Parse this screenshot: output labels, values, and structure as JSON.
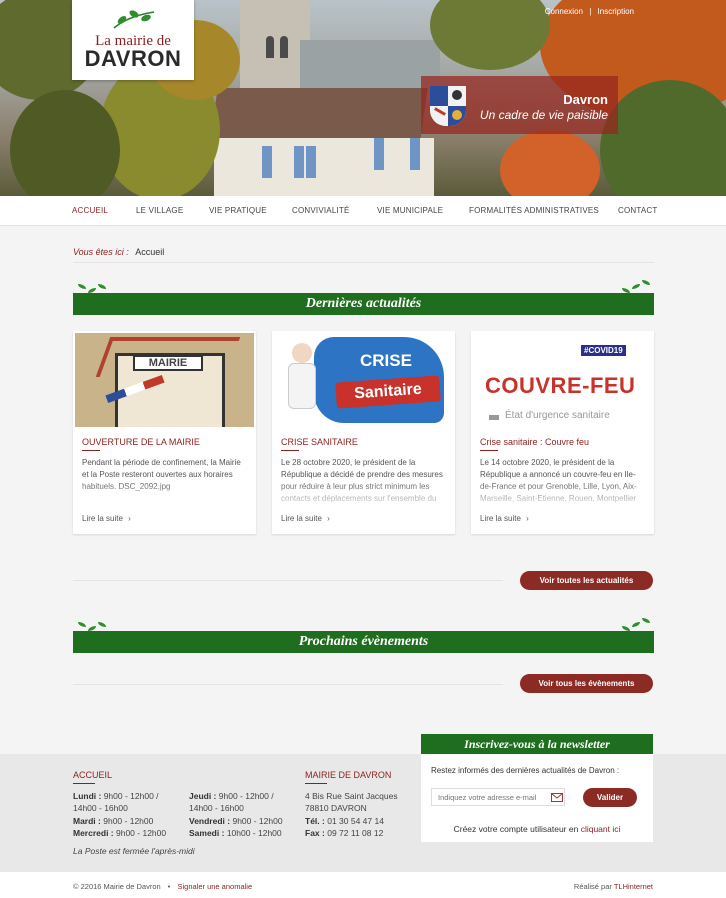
{
  "header": {
    "logo_line1": "La mairie de",
    "logo_line2": "DAVRON",
    "login": "Connexion",
    "separator": "|",
    "register": "Inscription",
    "banner_title": "Davron",
    "banner_subtitle": "Un cadre de vie paisible"
  },
  "nav": {
    "items": [
      "ACCUEIL",
      "LE VILLAGE",
      "VIE PRATIQUE",
      "CONVIVIALITÉ",
      "VIE MUNICIPALE",
      "FORMALITÉS ADMINISTRATIVES",
      "CONTACT"
    ]
  },
  "breadcrumb": {
    "label": "Vous êtes ici :",
    "current": "Accueil"
  },
  "news": {
    "heading": "Dernières actualités",
    "cards": [
      {
        "image_text": "MAIRIE",
        "title": "OUVERTURE DE LA MAIRIE",
        "text": "Pendant la période de confinement, la Mairie et la Poste resteront ouvertes aux horaires habituels. DSC_2092.jpg",
        "more": "Lire la suite"
      },
      {
        "image_text_1": "CRISE",
        "image_text_2": "Sanitaire",
        "title": "CRISE SANITAIRE",
        "text": "Le 28 octobre 2020, le président de la République a décidé de prendre des mesures pour réduire à leur plus strict minimum les contacts et déplacements sur l'ensemble du",
        "more": "Lire la suite"
      },
      {
        "image_tag": "#COVID19",
        "image_text_1": "COUVRE-FEU",
        "image_text_2": "État d'urgence sanitaire",
        "title": "Crise sanitaire : Couvre feu",
        "text": "Le 14 octobre 2020, le président de la République a annoncé un couvre-feu en Ile-de-France et pour Grenoble, Lille, Lyon, Aix-Marseille, Saint-Etienne, Rouen, Montpellier",
        "more": "Lire la suite"
      }
    ],
    "all_button": "Voir toutes les actualités"
  },
  "events": {
    "heading": "Prochains évènements",
    "all_button": "Voir tous les évènements"
  },
  "footer": {
    "hours_heading": "ACCUEIL",
    "hours_left": [
      {
        "day": "Lundi :",
        "value": "9h00 - 12h00 /"
      },
      {
        "day": "",
        "value": "14h00 - 16h00"
      },
      {
        "day": "Mardi :",
        "value": "9h00 - 12h00"
      },
      {
        "day": "Mercredi :",
        "value": "9h00 - 12h00"
      }
    ],
    "hours_right": [
      {
        "day": "Jeudi :",
        "value": "9h00 - 12h00 /"
      },
      {
        "day": "",
        "value": "14h00 - 16h00"
      },
      {
        "day": "Vendredi :",
        "value": "9h00 - 12h00"
      },
      {
        "day": "Samedi :",
        "value": "10h00 - 12h00"
      }
    ],
    "note": "La Poste est fermée l'après-midi",
    "address_heading": "MAIRIE DE DAVRON",
    "address_lines": [
      "4 Bis Rue Saint Jacques",
      "78810 DAVRON"
    ],
    "phone_label": "Tél. :",
    "phone": "01 30 54 47 14",
    "fax_label": "Fax :",
    "fax": "09 72 11 08 12"
  },
  "newsletter": {
    "heading": "Inscrivez-vous à la newsletter",
    "description": "Restez informés des dernières actualités de Davron :",
    "placeholder": "Indiquez votre adresse e-mail",
    "button": "Valider",
    "account_text": "Créez votre compte utilisateur en",
    "account_link": "cliquant ici"
  },
  "bottom": {
    "copyright": "© 22016 Mairie de Davron",
    "bullet": "•",
    "report": "Signaler une anomalie",
    "credit_text": "Réalisé par",
    "credit_link": "TLHinternet"
  },
  "colors": {
    "brand_red": "#8b1f1f",
    "button_red": "#8c2a24",
    "section_green": "#1f6e1f"
  }
}
